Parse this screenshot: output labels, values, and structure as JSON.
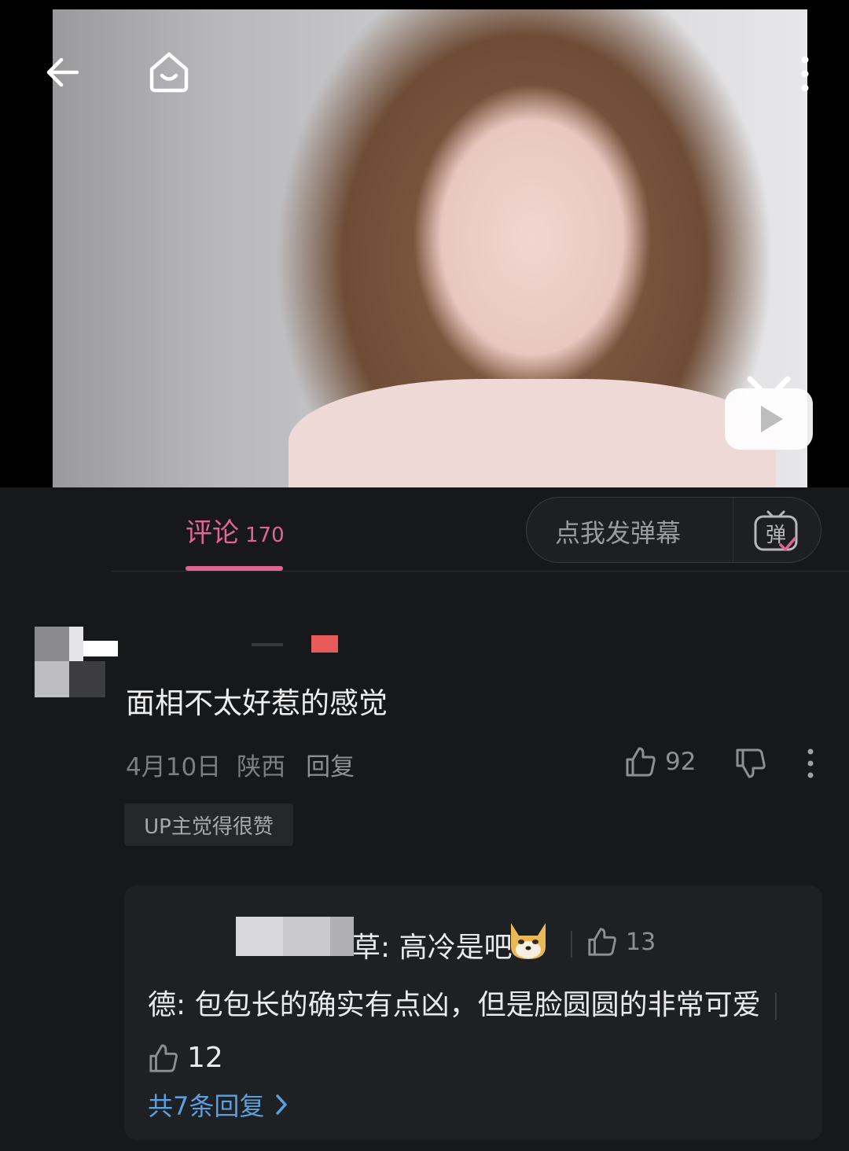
{
  "header": {
    "back_icon": "arrow-left-icon",
    "home_icon": "home-icon",
    "more_icon": "more-vertical-icon",
    "play_badge_icon": "bilibili-play-icon"
  },
  "tabs": {
    "comment_label": "评论",
    "comment_count": "170"
  },
  "danmaku": {
    "placeholder": "点我发弹幕",
    "icon_char": "弹"
  },
  "comment": {
    "text": "面相不太好惹的感觉",
    "date": "4月10日",
    "location": "陕西",
    "reply_label": "回复",
    "like_count": "92",
    "up_badge": "UP主觉得很赞"
  },
  "replies": {
    "reply1_text": "草: 高冷是吧",
    "reply1_like_count": "13",
    "reply2_text": "德: 包包长的确实有点凶，但是脸圆圆的非常可爱",
    "reply2_like_count": "12",
    "view_all": "共7条回复"
  },
  "colors": {
    "accent_pink": "#e0668f",
    "link_blue": "#5a9fe0",
    "background": "#17181a"
  }
}
